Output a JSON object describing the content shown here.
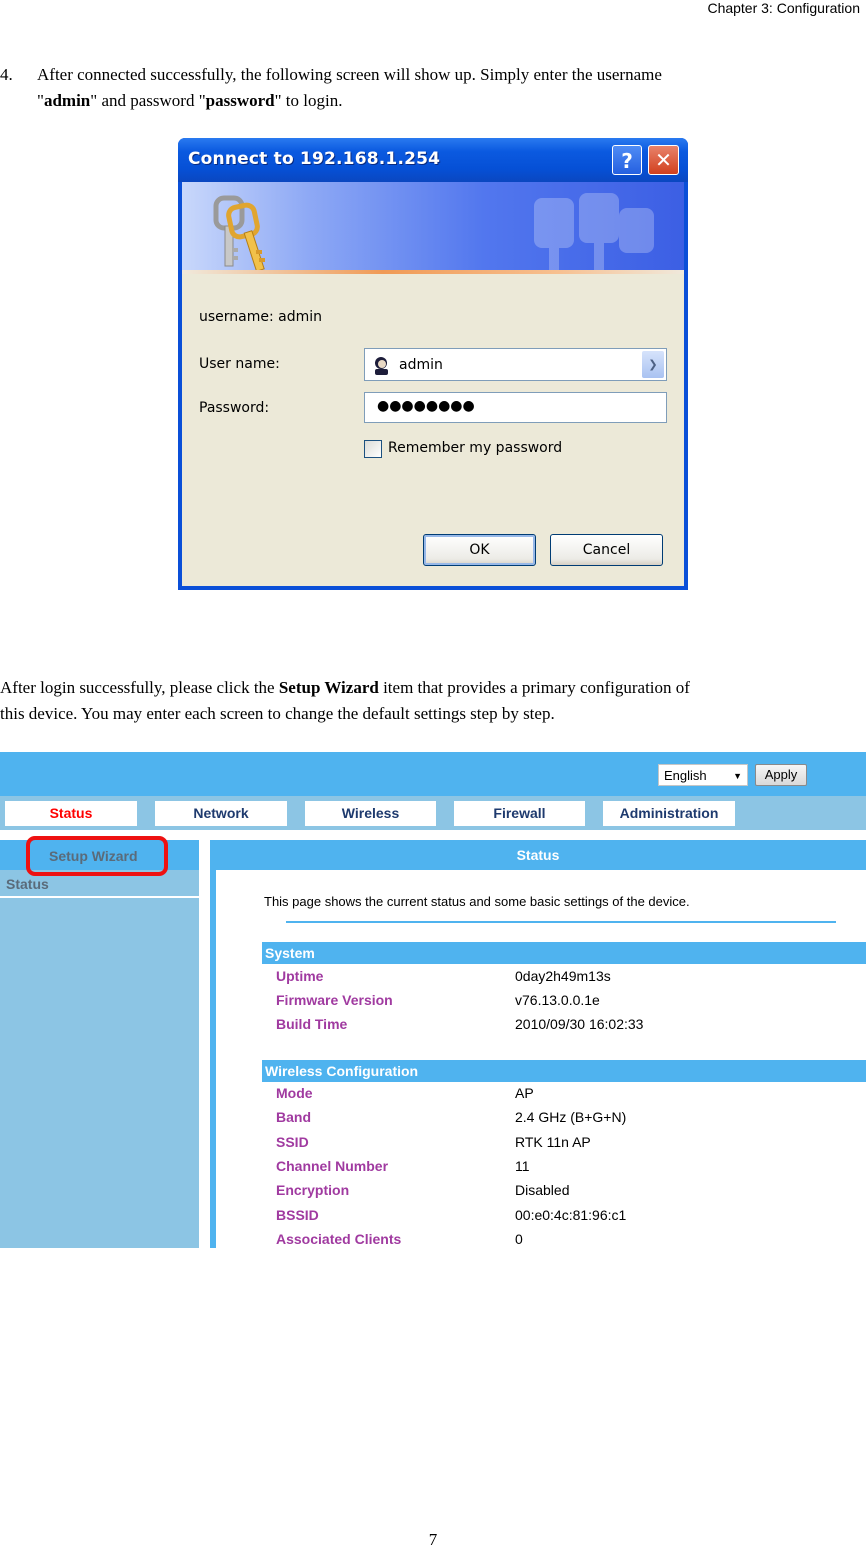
{
  "header": {
    "chapter": "Chapter 3: Configuration"
  },
  "step4": {
    "number": "4.",
    "line1": "After connected successfully, the following screen will show up. Simply enter the username",
    "line2_parts": [
      "\"",
      "admin",
      "\" and password \"",
      "password",
      "\" to login."
    ]
  },
  "login_dialog": {
    "title": "Connect to 192.168.1.254",
    "help_glyph": "?",
    "close_glyph": "✕",
    "banner_icon": "keys-icon",
    "realm_text": "username: admin",
    "username_label": "User name:",
    "username_value": "admin",
    "password_label": "Password:",
    "password_value": "●●●●●●●●",
    "remember_label": "Remember my password",
    "remember_checked": false,
    "ok_label": "OK",
    "cancel_label": "Cancel"
  },
  "after_login": {
    "parts": [
      "After login successfully, please click the ",
      "Setup Wizard",
      " item that provides a primary configuration of"
    ],
    "line2": "this device. You may enter each screen to change the default settings step by step."
  },
  "router_ui": {
    "colors": {
      "primary": "#4fb3ef",
      "nav_bg": "#8cc5e4",
      "active_tab": "#ff0000",
      "label": "#a03aa0",
      "highlight": "#ee1111"
    },
    "language": {
      "selected": "English",
      "arrow": "▼"
    },
    "apply_label": "Apply",
    "tabs": [
      {
        "label": "Status",
        "active": true
      },
      {
        "label": "Network",
        "active": false
      },
      {
        "label": "Wireless",
        "active": false
      },
      {
        "label": "Firewall",
        "active": false
      },
      {
        "label": "Administration",
        "active": false
      }
    ],
    "sidebar": {
      "setup_wizard": "Setup Wizard",
      "status": "Status"
    },
    "content": {
      "title": "Status",
      "description": "This page shows the current status and some basic settings of the device.",
      "system": {
        "header": "System",
        "rows": [
          {
            "key": "Uptime",
            "value": "0day2h49m13s"
          },
          {
            "key": "Firmware Version",
            "value": "v76.13.0.0.1e"
          },
          {
            "key": "Build Time",
            "value": "2010/09/30 16:02:33"
          }
        ]
      },
      "wireless": {
        "header": "Wireless  Configuration",
        "rows": [
          {
            "key": "Mode",
            "value": "AP"
          },
          {
            "key": "Band",
            "value": "2.4 GHz (B+G+N)"
          },
          {
            "key": "SSID",
            "value": "RTK 11n AP"
          },
          {
            "key": "Channel Number",
            "value": "11"
          },
          {
            "key": "Encryption",
            "value": "Disabled"
          },
          {
            "key": "BSSID",
            "value": "00:e0:4c:81:96:c1"
          },
          {
            "key": "Associated Clients",
            "value": "0"
          }
        ]
      }
    }
  },
  "footer": {
    "page_number": "7"
  }
}
